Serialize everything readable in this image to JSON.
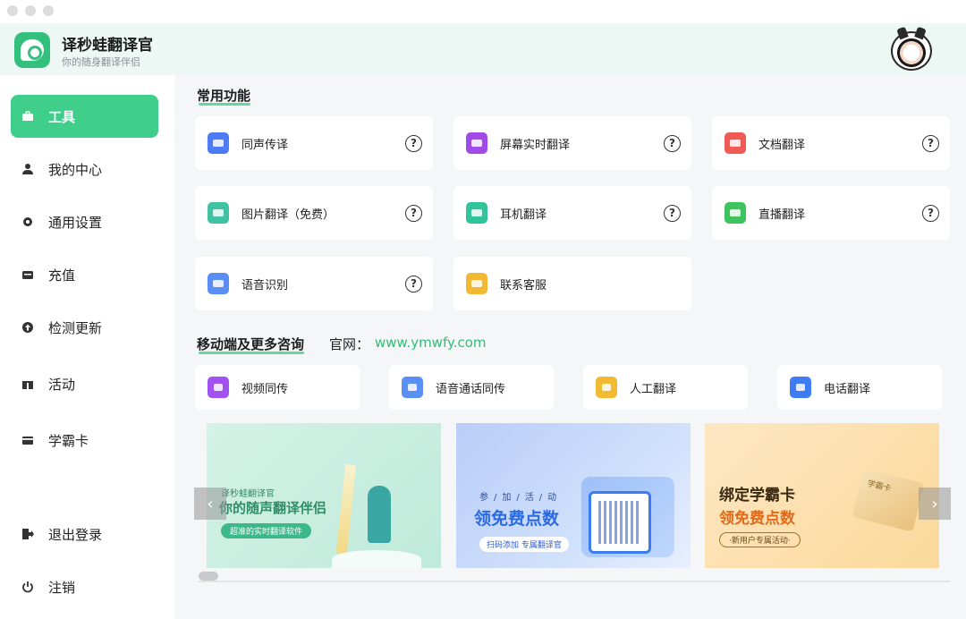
{
  "header": {
    "app_title": "译秒蛙翻译官",
    "app_subtitle": "你的随身翻译伴侣"
  },
  "sidebar": {
    "items": [
      {
        "label": "工具",
        "icon": "toolbox-icon",
        "active": true
      },
      {
        "label": "我的中心",
        "icon": "user-icon"
      },
      {
        "label": "通用设置",
        "icon": "gear-icon"
      },
      {
        "label": "充值",
        "icon": "wallet-icon"
      },
      {
        "label": "检测更新",
        "icon": "upload-circle-icon"
      },
      {
        "label": "活动",
        "icon": "gift-icon"
      },
      {
        "label": "学霸卡",
        "icon": "card-icon"
      },
      {
        "label": "退出登录",
        "icon": "logout-icon"
      },
      {
        "label": "注销",
        "icon": "power-icon"
      }
    ]
  },
  "common": {
    "title": "常用功能",
    "cards": [
      {
        "label": "同声传译",
        "color": "#4c7bf3"
      },
      {
        "label": "屏幕实时翻译",
        "color": "#a04be8"
      },
      {
        "label": "文档翻译",
        "color": "#ef5a55"
      },
      {
        "label": "图片翻译（免费）",
        "color": "#41c3a3"
      },
      {
        "label": "耳机翻译",
        "color": "#31c39a"
      },
      {
        "label": "直播翻译",
        "color": "#3ec45e"
      },
      {
        "label": "语音识别",
        "color": "#5b8ef5"
      },
      {
        "label": "联系客服",
        "color": "#f2b733"
      }
    ],
    "help_symbol": "?"
  },
  "mobile": {
    "title": "移动端及更多咨询",
    "site_label": "官网：",
    "site_url": "www.ymwfy.com",
    "cards": [
      {
        "label": "视频同传",
        "color": "#a152f0"
      },
      {
        "label": "语音通话同传",
        "color": "#5a8ff5"
      },
      {
        "label": "人工翻译",
        "color": "#f2b933"
      },
      {
        "label": "电话翻译",
        "color": "#3f7cf4"
      }
    ]
  },
  "banners": [
    {
      "small": "译秒蛙翻译官",
      "big": "你的随声翻译伴侣",
      "pill": "超准的实时翻译软件"
    },
    {
      "small": "参/加/活/动",
      "big": "领免费点数",
      "pill": "扫码添加  专属翻译官"
    },
    {
      "big1": "绑定学霸卡",
      "big2": "领免费点数",
      "pill": "·新用户专属活动·",
      "card_text": "学霸卡"
    }
  ],
  "carousel": {
    "prev": "‹",
    "next": "›"
  }
}
